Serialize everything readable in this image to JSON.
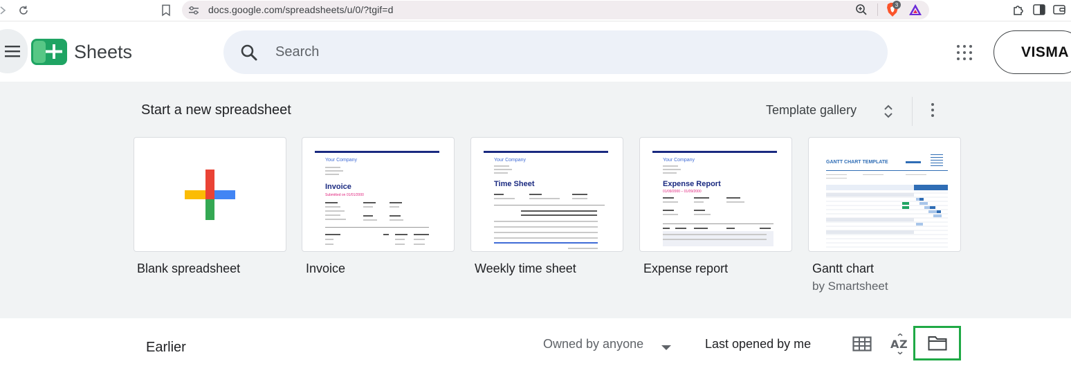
{
  "browser": {
    "url": "docs.google.com/spreadsheets/u/0/?tgif=d",
    "brave_badge_count": "3"
  },
  "header": {
    "app_name": "Sheets",
    "search_placeholder": "Search",
    "account_logo": "VISMA"
  },
  "templates": {
    "section_title": "Start a new spreadsheet",
    "gallery_label": "Template gallery",
    "items": [
      {
        "label": "Blank spreadsheet",
        "sub": ""
      },
      {
        "label": "Invoice",
        "sub": ""
      },
      {
        "label": "Weekly time sheet",
        "sub": ""
      },
      {
        "label": "Expense report",
        "sub": ""
      },
      {
        "label": "Gantt chart",
        "sub": "by Smartsheet"
      }
    ],
    "previews": {
      "company": "Your Company",
      "invoice_title": "Invoice",
      "invoice_sub": "Submitted on 01/01/2000",
      "timesheet_title": "Time Sheet",
      "expense_title": "Expense Report",
      "expense_sub": "01/09/2000 – 01/09/2000",
      "gantt_title": "GANTT CHART TEMPLATE"
    }
  },
  "files": {
    "section_title": "Earlier",
    "owner_filter": "Owned by anyone",
    "sort_label": "Last opened by me"
  },
  "colors": {
    "sheets_green": "#1fa463",
    "highlight_border": "#1fa945",
    "template_bg": "#f1f3f4"
  }
}
